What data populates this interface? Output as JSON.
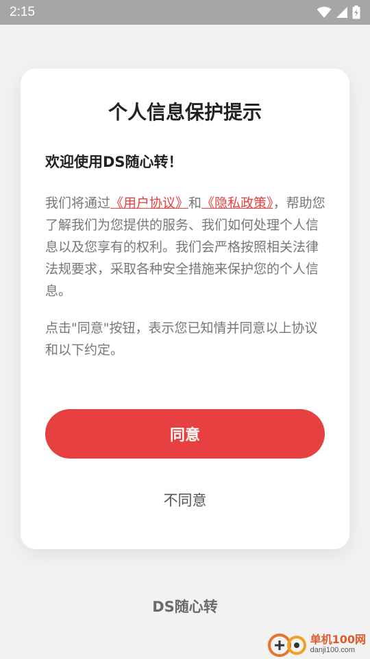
{
  "status_bar": {
    "time": "2:15",
    "icons": [
      "wifi-icon",
      "signal-icon",
      "battery-charging-icon"
    ]
  },
  "dialog": {
    "title": "个人信息保护提示",
    "welcome": "欢迎使用DS随心转！",
    "paragraph1": {
      "prefix": "我们将通过",
      "user_agreement_link": "《用户协议》",
      "connector": "和",
      "privacy_policy_link": "《隐私政策》",
      "suffix": "，帮助您了解我们为您提供的服务、我们如何处理个人信息以及您享有的权利。我们会严格按照相关法律法规要求，采取各种安全措施来保护您的个人信息。"
    },
    "paragraph2": "点击\"同意\"按钮，表示您已知情并同意以上协议和以下约定。",
    "agree_label": "同意",
    "disagree_label": "不同意"
  },
  "footer": {
    "app_name": "DS随心转"
  },
  "watermark": {
    "name": "单机100网",
    "url": "danji100.com"
  },
  "colors": {
    "accent": "#e64040",
    "status_bar": "#a6a6a6",
    "background": "#f2f2f2"
  }
}
